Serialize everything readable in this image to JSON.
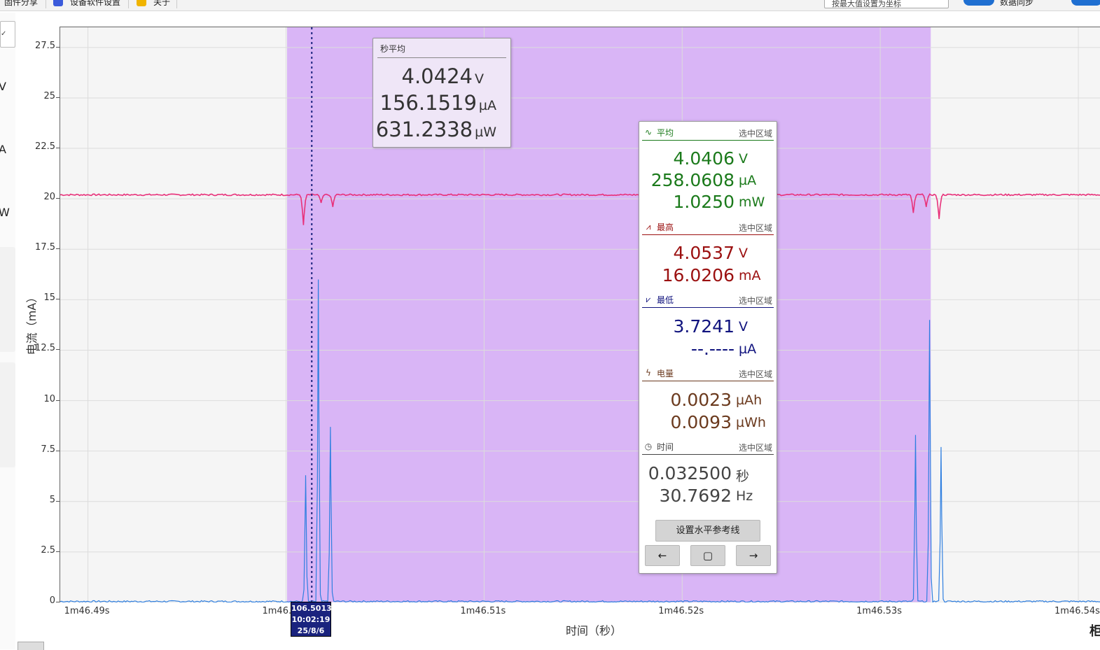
{
  "topbar": {
    "item1": "固件分享",
    "item2": "设备软件设置",
    "item3": "关于",
    "search_value": "按最大值设置为坐标",
    "toggle_label": "数据同步"
  },
  "left_panel": {
    "units": [
      "V",
      "A",
      "W"
    ]
  },
  "chart_data": {
    "type": "line",
    "ylabel": "电流（mA）",
    "xlabel": "时间（秒）",
    "ylim": [
      0,
      28.5
    ],
    "y_ticks": [
      "27.5",
      "25",
      "22.5",
      "20",
      "17.5",
      "15",
      "12.5",
      "10",
      "7.5",
      "5",
      "2.5",
      "0"
    ],
    "x_ticks": [
      "1m46.49s",
      "1m46.50s",
      "1m46.51s",
      "1m46.52s",
      "1m46.53s",
      "1m46.54s"
    ],
    "x_range_seconds": [
      106.4886,
      106.54113
    ],
    "selection_seconds": [
      106.50005,
      106.53255
    ],
    "cursor_seconds": 106.5013,
    "series": [
      {
        "color": "#e8317a",
        "baseline": 20.2,
        "dips": [
          {
            "x": 106.50088,
            "y": 18.7
          },
          {
            "x": 106.50177,
            "y": 19.8
          },
          {
            "x": 106.50236,
            "y": 19.6
          },
          {
            "x": 106.53167,
            "y": 19.3
          },
          {
            "x": 106.53232,
            "y": 19.6
          },
          {
            "x": 106.53297,
            "y": 19.0
          }
        ]
      },
      {
        "color": "#2f7fe0",
        "baseline": 0.05,
        "peaks": [
          {
            "x": 106.50099,
            "y": 6.3
          },
          {
            "x": 106.50163,
            "y": 16.0
          },
          {
            "x": 106.50224,
            "y": 8.7
          },
          {
            "x": 106.53178,
            "y": 8.3
          },
          {
            "x": 106.53249,
            "y": 14.0
          },
          {
            "x": 106.53307,
            "y": 7.7
          }
        ]
      }
    ]
  },
  "cursor": {
    "line1": "106.5013",
    "line2": "10:02:19",
    "line3": "25/8/6"
  },
  "second_average": {
    "title": "秒平均",
    "voltage": "4.0424",
    "voltage_unit": "V",
    "current": "156.1519",
    "current_unit": "µA",
    "power": "631.2338",
    "power_unit": "µW"
  },
  "stats": {
    "scope_label": "选中区域",
    "average": {
      "title": "平均",
      "color": "#1b7a1b",
      "voltage": "4.0406",
      "voltage_unit": "V",
      "current": "258.0608",
      "current_unit": "µA",
      "power": "1.0250",
      "power_unit": "mW"
    },
    "max": {
      "title": "最高",
      "color": "#9b1010",
      "voltage": "4.0537",
      "voltage_unit": "V",
      "current": "16.0206",
      "current_unit": "mA"
    },
    "min": {
      "title": "最低",
      "color": "#10137e",
      "voltage": "3.7241",
      "voltage_unit": "V",
      "current": "--.----",
      "current_unit": "µA"
    },
    "energy": {
      "title": "电量",
      "color": "#6b3a1e",
      "charge": "0.0023",
      "charge_unit": "µAh",
      "energy": "0.0093",
      "energy_unit": "µWh"
    },
    "time": {
      "title": "时间",
      "color": "#444444",
      "duration": "0.032500",
      "duration_unit": "秒",
      "frequency": "30.7692",
      "frequency_unit": "Hz"
    },
    "set_ref_label": "设置水平参考线",
    "left_label": "←",
    "center_label": "▢",
    "right_label": "→"
  },
  "bottom_right_fragment": "柜"
}
